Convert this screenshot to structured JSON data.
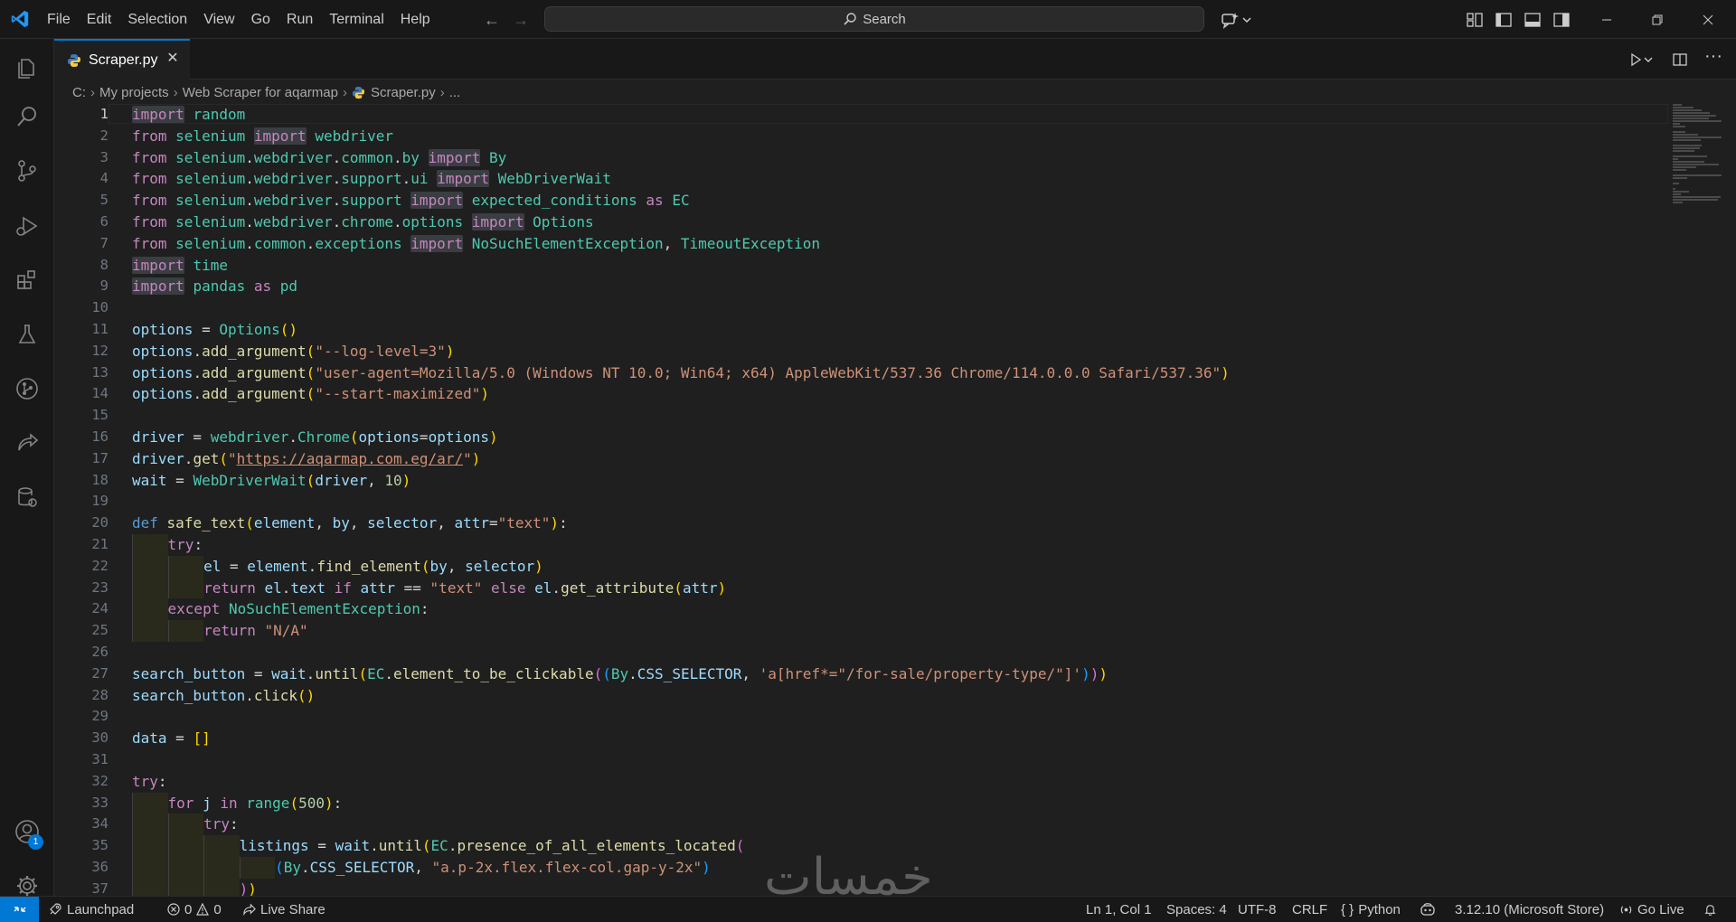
{
  "menu": [
    "File",
    "Edit",
    "Selection",
    "View",
    "Go",
    "Run",
    "Terminal",
    "Help"
  ],
  "search": {
    "label": "Search"
  },
  "tab": {
    "filename": "Scraper.py"
  },
  "breadcrumb": {
    "drive": "C:",
    "folder1": "My projects",
    "folder2": "Web Scraper for aqarmap",
    "file": "Scraper.py",
    "more": "..."
  },
  "editor": {
    "current_line": 1,
    "line_numbers": [
      "1",
      "2",
      "3",
      "4",
      "5",
      "6",
      "7",
      "8",
      "9",
      "10",
      "11",
      "12",
      "13",
      "14",
      "15",
      "16",
      "17",
      "18",
      "19",
      "20",
      "21",
      "22",
      "23",
      "24",
      "25",
      "26",
      "27",
      "28",
      "29",
      "30",
      "31",
      "32",
      "33",
      "34",
      "35",
      "36",
      "37"
    ]
  },
  "accounts_badge": "1",
  "watermark": "خمسات",
  "status": {
    "launchpad": "Launchpad",
    "errors": "0",
    "warnings": "0",
    "live_share": "Live Share",
    "position": "Ln 1, Col 1",
    "spaces": "Spaces: 4",
    "encoding": "UTF-8",
    "eol": "CRLF",
    "language": "Python",
    "interpreter": "3.12.10 (Microsoft Store)",
    "go_live": "Go Live"
  },
  "colors": {
    "accent": "#0078d4",
    "background": "#1f1f1f",
    "chrome": "#181818"
  }
}
